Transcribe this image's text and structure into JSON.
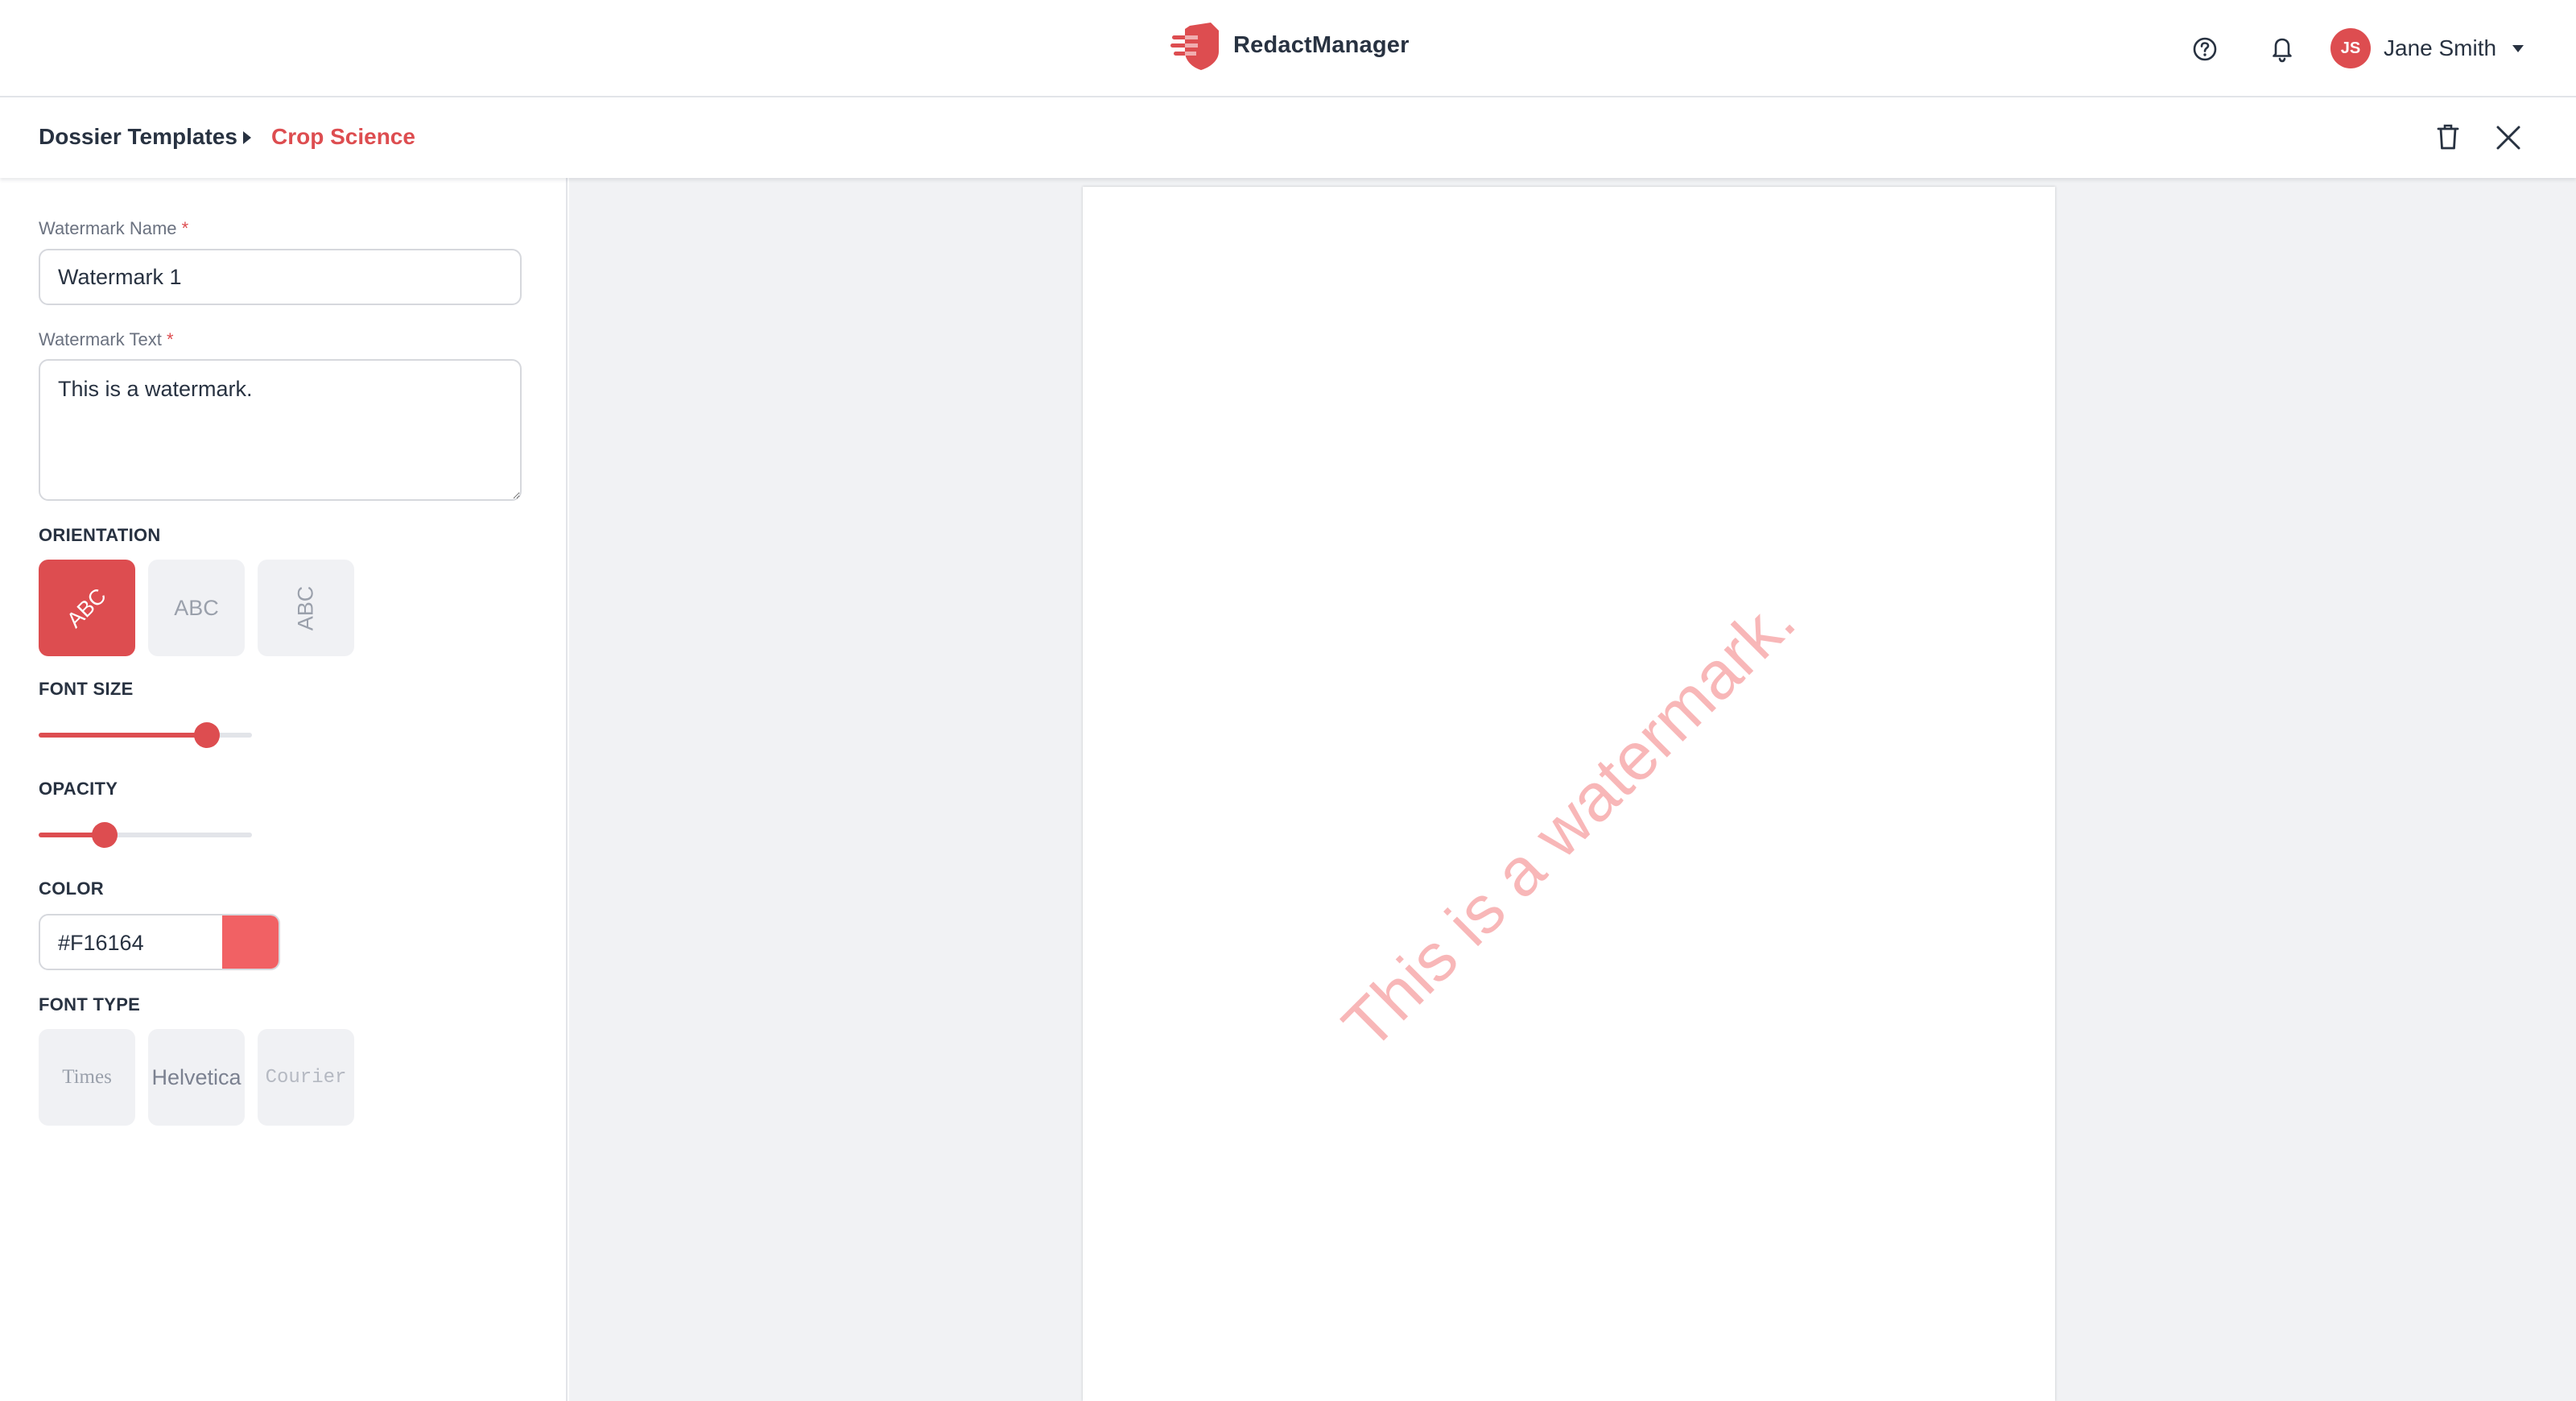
{
  "header": {
    "brand": "RedactManager",
    "user": {
      "initials": "JS",
      "name": "Jane Smith"
    }
  },
  "breadcrumb": {
    "root": "Dossier Templates",
    "current": "Crop Science"
  },
  "form": {
    "name_label": "Watermark Name",
    "name_value": "Watermark 1",
    "text_label": "Watermark Text",
    "text_value": "This is a watermark.",
    "required_mark": "*",
    "orientation": {
      "label": "ORIENTATION",
      "options": [
        "ABC",
        "ABC",
        "ABC"
      ],
      "selected": "diagonal"
    },
    "font_size": {
      "label": "FONT SIZE",
      "value_fraction": 0.79
    },
    "opacity": {
      "label": "OPACITY",
      "value_fraction": 0.31
    },
    "color": {
      "label": "COLOR",
      "value": "#F16164"
    },
    "font_type": {
      "label": "FONT TYPE",
      "options": [
        "Times",
        "Helvetica",
        "Courier"
      ],
      "selected": "Helvetica"
    }
  },
  "preview": {
    "watermark_text": "This is a watermark."
  },
  "icons": {
    "logo": "shield-logo-icon",
    "help": "help-circle-icon",
    "notifications": "bell-icon",
    "user_menu": "chevron-down-icon",
    "breadcrumb_separator": "caret-right-icon",
    "delete": "trash-icon",
    "close": "close-icon"
  },
  "colors": {
    "accent": "#dd4d50",
    "watermark": "#F16164",
    "text": "#283241",
    "preview_bg": "#f1f2f4"
  }
}
